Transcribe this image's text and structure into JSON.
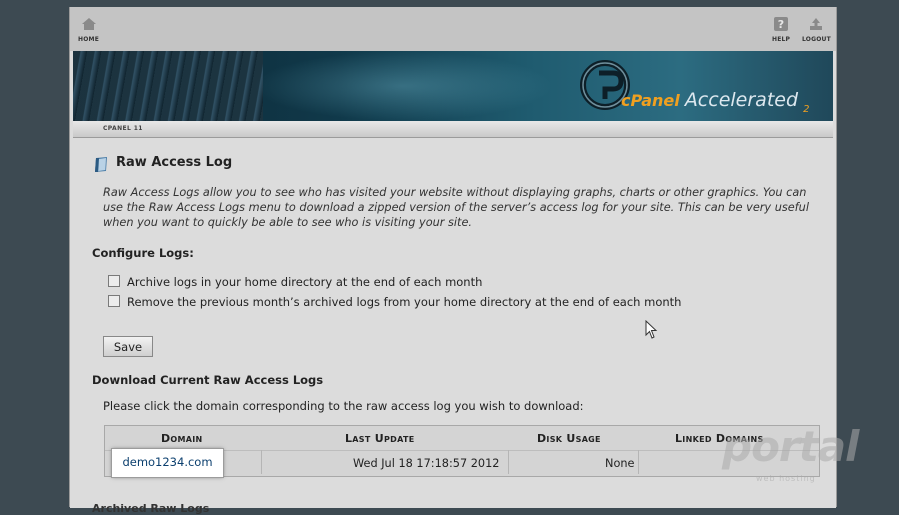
{
  "topbar": {
    "home_label": "HOME",
    "help_label": "HELP",
    "logout_label": "LOGOUT"
  },
  "banner": {
    "brand": "cPanel",
    "product": "Accelerated",
    "version": "2"
  },
  "breadcrumb": "CPANEL 11",
  "page": {
    "title": "Raw Access Log",
    "description": "Raw Access Logs allow you to see who has visited your website without displaying graphs, charts or other graphics. You can use the Raw Access Logs menu to download a zipped version of the server’s access log for your site. This can be very useful when you want to quickly be able to see who is visiting your site."
  },
  "configure": {
    "heading": "Configure Logs:",
    "options": [
      {
        "label": "Archive logs in your home directory at the end of each month",
        "checked": false
      },
      {
        "label": "Remove the previous month’s archived logs from your home directory at the end of each month",
        "checked": false
      }
    ],
    "save_label": "Save"
  },
  "download": {
    "heading": "Download Current Raw Access Logs",
    "instruction": "Please click the domain corresponding to the raw access log you wish to download:",
    "columns": [
      "Domain",
      "Last Update",
      "Disk Usage",
      "Linked Domains"
    ],
    "rows": [
      {
        "domain": "demo1234.com",
        "last_update": "Wed Jul 18 17:18:57 2012",
        "disk_usage": "None",
        "linked_domains": ""
      }
    ]
  },
  "cut_off_heading": "Archived Raw Logs",
  "watermark": {
    "text": "portal",
    "sub": "web hosting"
  },
  "colors": {
    "outer_background": "#3d4a52",
    "page_background": "#dcdcdc",
    "link": "#0b3f6e",
    "brand_orange": "#f0a020"
  }
}
